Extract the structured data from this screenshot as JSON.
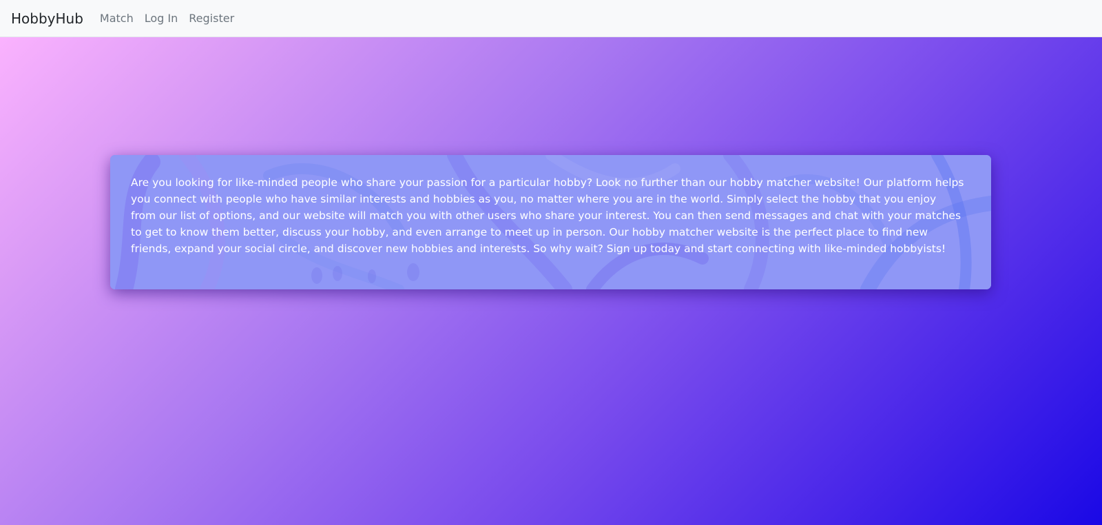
{
  "navbar": {
    "brand": "HobbyHub",
    "links": [
      {
        "label": "Match"
      },
      {
        "label": "Log In"
      },
      {
        "label": "Register"
      }
    ]
  },
  "main": {
    "intro_text": "Are you looking for like-minded people who share your passion for a particular hobby? Look no further than our hobby matcher website! Our platform helps you connect with people who have similar interests and hobbies as you, no matter where you are in the world. Simply select the hobby that you enjoy from our list of options, and our website will match you with other users who share your interest. You can then send messages and chat with your matches to get to know them better, discuss your hobby, and even arrange to meet up in person. Our hobby matcher website is the perfect place to find new friends, expand your social circle, and discover new hobbies and interests. So why wait? Sign up today and start connecting with like-minded hobbyists!"
  },
  "colors": {
    "navbar_bg": "#f8f9fa",
    "card_tint": "#8c93f5",
    "gradient_start": "#ffb6ff",
    "gradient_end": "#1a08e6"
  }
}
